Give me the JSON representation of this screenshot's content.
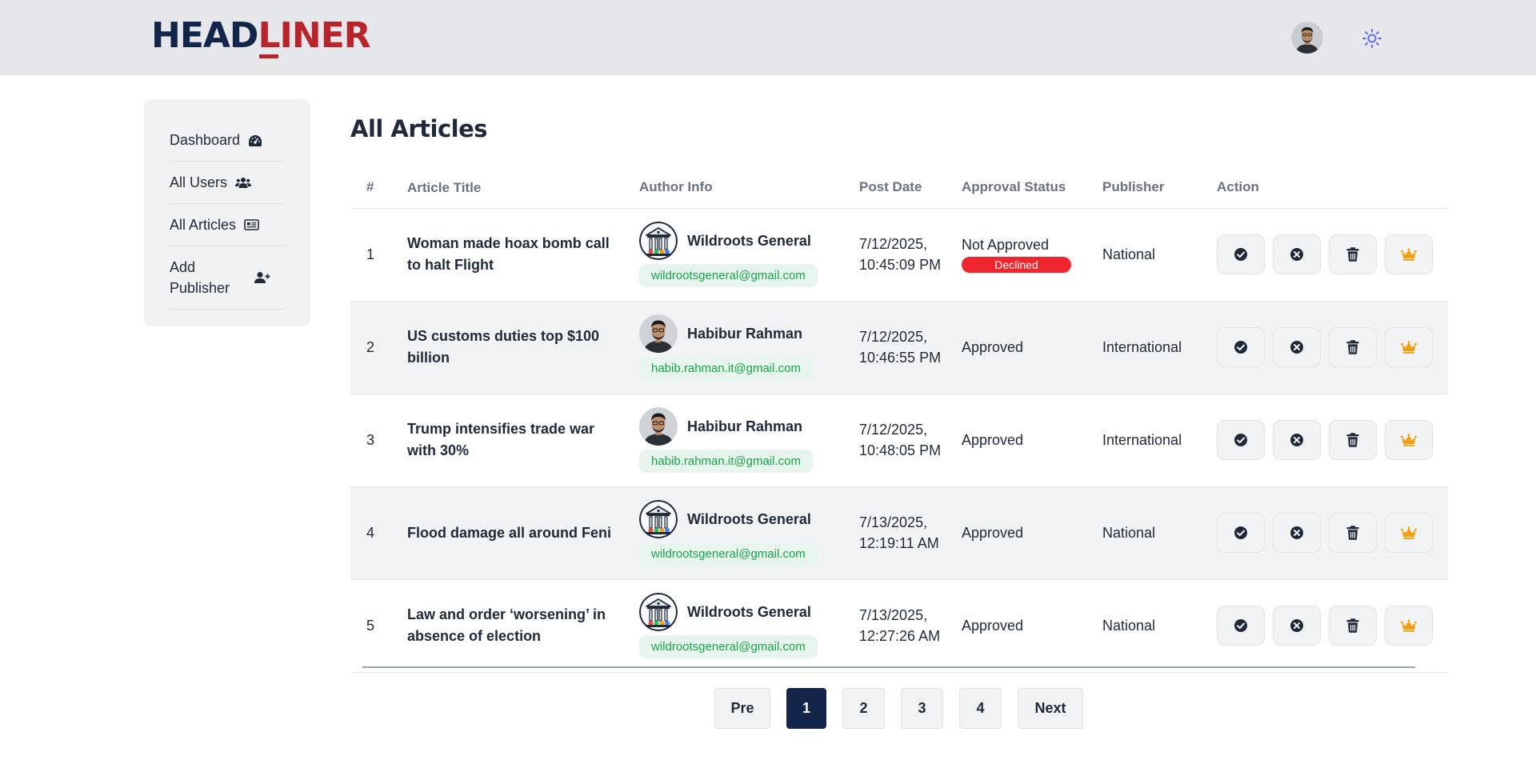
{
  "header": {
    "logo_head": "HEAD",
    "logo_l": "L",
    "logo_rest": "INER"
  },
  "sidebar": {
    "items": [
      {
        "label": "Dashboard",
        "icon": "gauge-icon"
      },
      {
        "label": "All Users",
        "icon": "users-icon"
      },
      {
        "label": "All Articles",
        "icon": "newspaper-icon"
      },
      {
        "label": "Add Publisher",
        "icon": "user-plus-icon"
      }
    ]
  },
  "page": {
    "title": "All Articles"
  },
  "table": {
    "columns": [
      "#",
      "Article Title",
      "Author Info",
      "Post Date",
      "Approval Status",
      "Publisher",
      "Action"
    ],
    "rows": [
      {
        "num": "1",
        "title": "Woman made hoax bomb call to halt Flight",
        "author": "Wildroots General",
        "email": "wildrootsgeneral@gmail.com",
        "avatar": "building-avatar",
        "date": "7/12/2025, 10:45:09 PM",
        "status": "Not Approved",
        "badge": "Declined",
        "publisher": "National"
      },
      {
        "num": "2",
        "title": "US customs duties top $100 billion",
        "author": "Habibur Rahman",
        "email": "habib.rahman.it@gmail.com",
        "avatar": "person-avatar",
        "date": "7/12/2025, 10:46:55 PM",
        "status": "Approved",
        "badge": "",
        "publisher": "International"
      },
      {
        "num": "3",
        "title": "Trump intensifies trade war with 30%",
        "author": "Habibur Rahman",
        "email": "habib.rahman.it@gmail.com",
        "avatar": "person-avatar",
        "date": "7/12/2025, 10:48:05 PM",
        "status": "Approved",
        "badge": "",
        "publisher": "International"
      },
      {
        "num": "4",
        "title": "Flood damage all around Feni",
        "author": "Wildroots General",
        "email": "wildrootsgeneral@gmail.com",
        "avatar": "building-avatar",
        "date": "7/13/2025, 12:19:11 AM",
        "status": "Approved",
        "badge": "",
        "publisher": "National"
      },
      {
        "num": "5",
        "title": "Law and order ‘worsening’ in absence of election",
        "author": "Wildroots General",
        "email": "wildrootsgeneral@gmail.com",
        "avatar": "building-avatar",
        "date": "7/13/2025, 12:27:26 AM",
        "status": "Approved",
        "badge": "",
        "publisher": "National"
      }
    ],
    "actions": [
      "approve-icon",
      "decline-icon",
      "trash-icon",
      "crown-icon"
    ]
  },
  "pagination": {
    "prev": "Pre",
    "pages": [
      "1",
      "2",
      "3",
      "4"
    ],
    "current": "1",
    "next": "Next"
  },
  "colors": {
    "brand_navy": "#13264a",
    "brand_red": "#b8232c",
    "declined_badge": "#f0262f",
    "email_text": "#16a34a",
    "crown": "#f59e0b"
  }
}
